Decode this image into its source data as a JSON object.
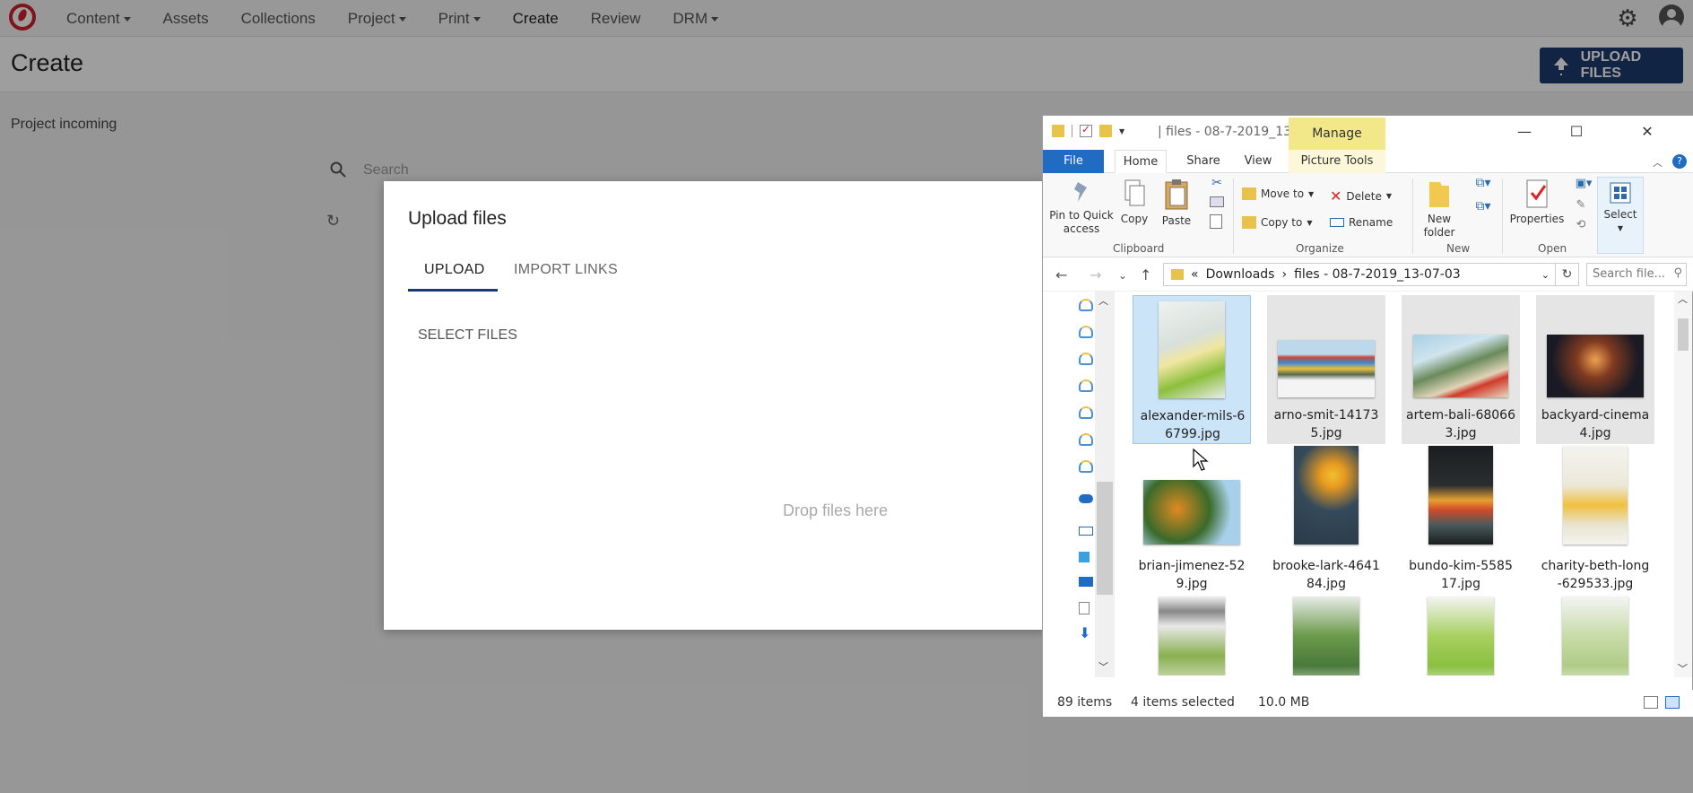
{
  "app": {
    "nav": [
      {
        "label": "Content",
        "caret": true
      },
      {
        "label": "Assets",
        "caret": false
      },
      {
        "label": "Collections",
        "caret": false
      },
      {
        "label": "Project",
        "caret": true
      },
      {
        "label": "Print",
        "caret": true
      },
      {
        "label": "Create",
        "caret": false
      },
      {
        "label": "Review",
        "caret": false
      },
      {
        "label": "DRM",
        "caret": true
      }
    ],
    "page_title": "Create",
    "upload_button": "UPLOAD FILES",
    "project_label": "Project incoming",
    "search_placeholder": "Search",
    "accent": "#1e3b6e"
  },
  "modal": {
    "title": "Upload files",
    "tabs": [
      "UPLOAD",
      "IMPORT LINKS"
    ],
    "select_files": "SELECT FILES",
    "drop_text": "Drop files here"
  },
  "explorer": {
    "title": "| files - 08-7-2019_13...",
    "manage": "Manage",
    "tabs": [
      "File",
      "Home",
      "Share",
      "View",
      "Picture Tools"
    ],
    "ribbon": {
      "pin": "Pin to Quick access",
      "copy": "Copy",
      "paste": "Paste",
      "move_to": "Move to",
      "copy_to": "Copy to",
      "delete": "Delete",
      "rename": "Rename",
      "new_folder": "New folder",
      "properties": "Properties",
      "select": "Select",
      "groups": [
        "Clipboard",
        "Organize",
        "New",
        "Open"
      ]
    },
    "address": {
      "crumbs": [
        "Downloads",
        "files - 08-7-2019_13-07-03"
      ],
      "search_placeholder": "Search file..."
    },
    "files": [
      {
        "name": "alexander-mils-66799.jpg",
        "display": "alexander-mils-6 6799.jpg"
      },
      {
        "name": "arno-smit-141735.jpg",
        "display": "arno-smit-14173 5.jpg"
      },
      {
        "name": "artem-bali-680663.jpg",
        "display": "artem-bali-68066 3.jpg"
      },
      {
        "name": "backyard-cinema4.jpg",
        "display": "backyard-cinema 4.jpg"
      },
      {
        "name": "brian-jimenez-529.jpg",
        "display": "brian-jimenez-52 9.jpg"
      },
      {
        "name": "brooke-lark-464184.jpg",
        "display": "brooke-lark-4641 84.jpg"
      },
      {
        "name": "bundo-kim-558517.jpg",
        "display": "bundo-kim-5585 17.jpg"
      },
      {
        "name": "charity-beth-long-629533.jpg",
        "display": "charity-beth-long -629533.jpg"
      }
    ],
    "status": {
      "count": "89 items",
      "selected": "4 items selected",
      "size": "10.0 MB"
    }
  }
}
